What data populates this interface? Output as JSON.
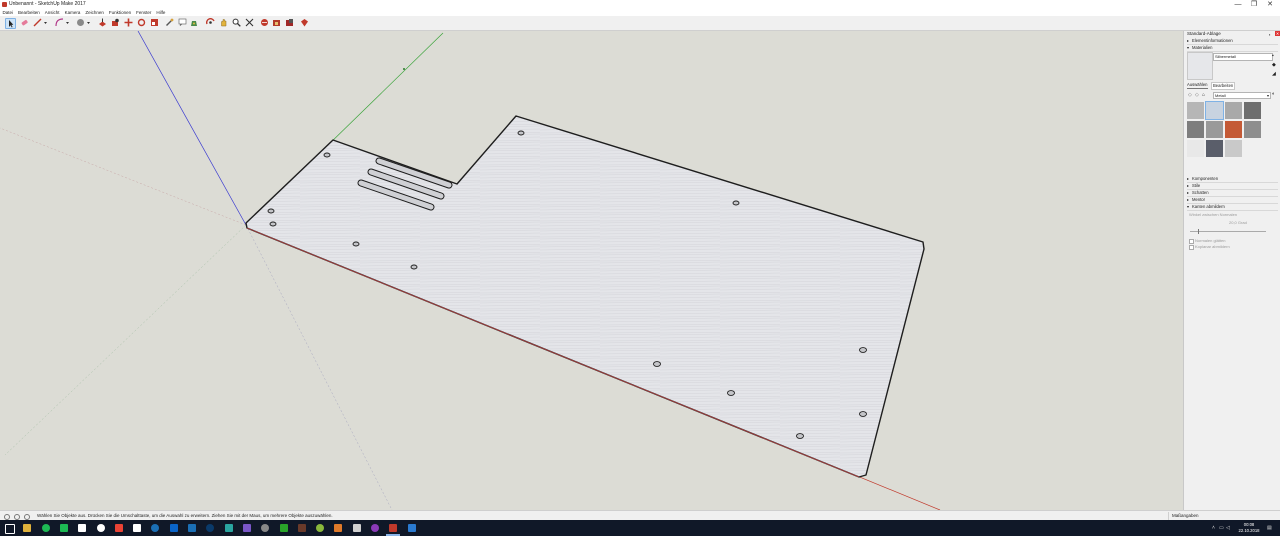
{
  "window": {
    "title": "Unbenannt - SketchUp Make 2017",
    "controls": [
      "—",
      "❐",
      "✕"
    ]
  },
  "menu": [
    "Datei",
    "Bearbeiten",
    "Ansicht",
    "Kamera",
    "Zeichnen",
    "Funktionen",
    "Fenster",
    "Hilfe"
  ],
  "toolbar": {
    "tools": [
      "select-tool",
      "eraser-tool",
      "line-tool",
      "arc-tool",
      "shape-tool",
      "pushpull-tool",
      "followme-tool",
      "move-tool",
      "rotate-tool",
      "scale-tool",
      "tape-tool",
      "text-tool",
      "paint-tool",
      "orbit-tool",
      "pan-tool",
      "zoom-tool",
      "zoom-extents-tool",
      "components-tool",
      "warehouse-tool",
      "extension-tool",
      "send-tool",
      "ruby-tool"
    ]
  },
  "colors": {
    "viewport_bg": "#dcdcd5",
    "axis_red": "#c0392b",
    "axis_green": "#3aa33a",
    "axis_blue": "#3b3bd0",
    "plate": "#e4e5e9",
    "taskbar": "#101828"
  },
  "tray": {
    "title": "Standard-Ablage",
    "sections": {
      "entity_info": "Elementinformationen",
      "materials": "Materialien",
      "components": "Komponenten",
      "styles": "Stile",
      "shadows": "Schatten",
      "instructor": "Mentor",
      "soften_edges": "Kanten abmildern"
    },
    "material_name": "Silbermetall",
    "tabs": [
      "Auswählen",
      "Bearbeiten"
    ],
    "library": "Metall",
    "swatch_colors": [
      "#b6b6b6",
      "#c8d3e0",
      "#a9a9a9",
      "#6e6e6e",
      "#7e7e7e",
      "#9a9a9a",
      "#c45a36",
      "#8e8e8e",
      "#e8e8e8",
      "#5a5e6a",
      "#c9c9c9"
    ],
    "soften": {
      "angle_label": "Winkel zwischen Normalen",
      "angle_value": "20,0 Grad",
      "smooth_normals": "Normalen glätten",
      "soften_coplanar": "Koplanar abmildern"
    }
  },
  "status": {
    "message": "Wählen Sie Objekte aus. Drücken Sie die Umschalttaste, um die Auswahl zu erweitern. Ziehen Sie mit der Maus, um mehrere Objekte auszuwählen.",
    "measurements_label": "Maßangaben"
  },
  "taskbar": {
    "time": "00:08",
    "date": "22.10.2018",
    "apps": [
      "start",
      "explorer",
      "spotify",
      "spotify2",
      "file-manager",
      "notepad",
      "chrome",
      "store",
      "steam",
      "outlook",
      "mail",
      "steam2",
      "arduino",
      "visual-studio",
      "calculator",
      "app-1",
      "app-2",
      "app-3",
      "app-4",
      "obs",
      "app-5",
      "sketchup",
      "app-6"
    ]
  }
}
